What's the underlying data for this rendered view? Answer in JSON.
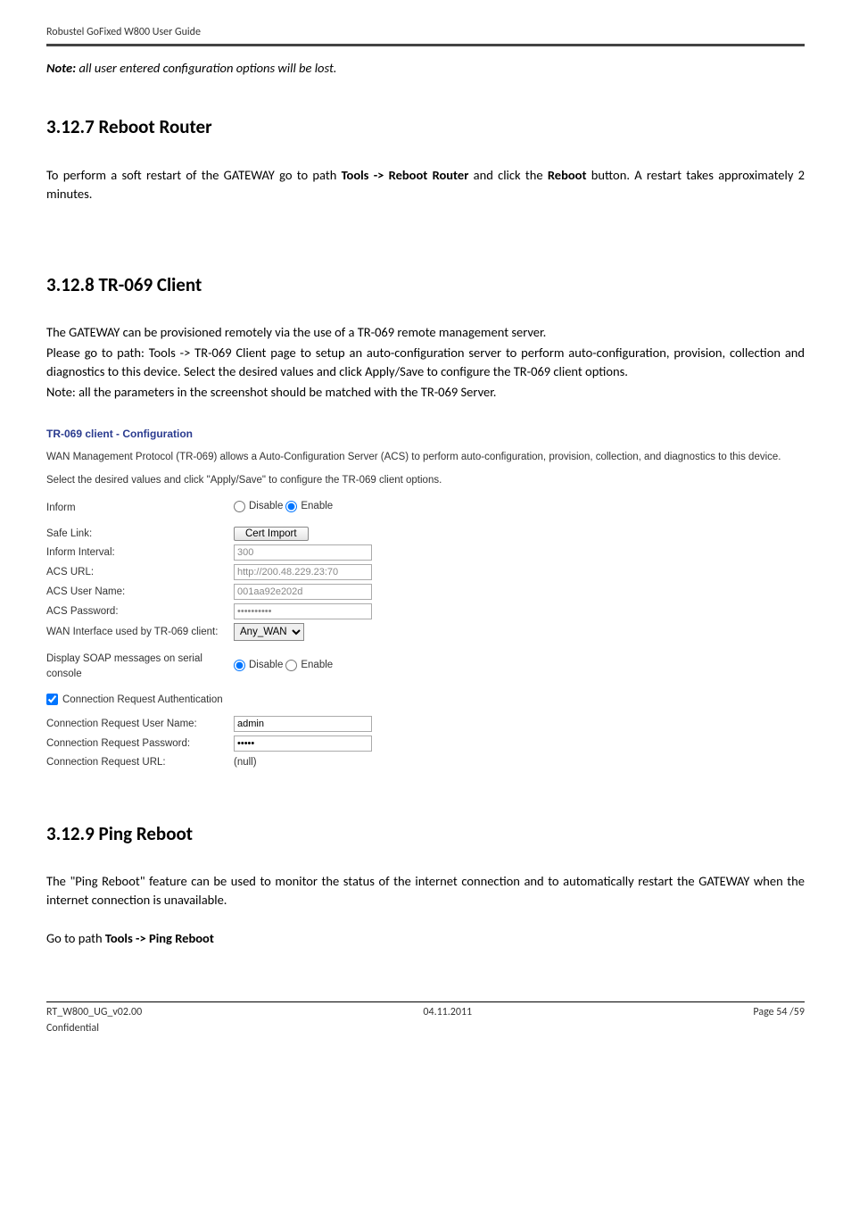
{
  "header": {
    "product": "Robustel GoFixed W800 User Guide"
  },
  "note": {
    "label": "Note:",
    "text": " all user entered configuration options will be lost."
  },
  "sections": {
    "s1_title": "3.12.7 Reboot Router",
    "s1_body": "To perform a soft restart of the GATEWAY go to path Tools -> Reboot Router and click the Reboot button. A restart takes approximately 2 minutes.",
    "s1_body_pre": "To perform a soft restart of the GATEWAY go to path ",
    "s1_bold1": "Tools -> Reboot Router",
    "s1_mid": " and click the ",
    "s1_bold2": "Reboot",
    "s1_post": " button. A restart takes approximately 2 minutes.",
    "s2_title": "3.12.8 TR-069 Client",
    "s2_p1": "The GATEWAY can be provisioned remotely via the use of a TR-069 remote management server.",
    "s2_p2": "Please go to path: Tools -> TR-069 Client page to setup an auto-configuration server to perform auto-configuration, provision, collection and diagnostics to this device. Select the desired values and click Apply/Save to configure the TR-069 client options.",
    "s2_p3": "Note: all the parameters in the screenshot should be matched with the TR-069 Server.",
    "s3_title": "3.12.9 Ping Reboot",
    "s3_p1": "The \"Ping Reboot\" feature can be used to monitor the status of the internet connection and to automatically restart the GATEWAY when the internet connection is unavailable.",
    "s3_p2_pre": "Go to path ",
    "s3_p2_bold": "Tools -> Ping Reboot"
  },
  "tr069": {
    "title": "TR-069 client - Configuration",
    "desc1": "WAN Management Protocol (TR-069) allows a Auto-Configuration Server (ACS) to perform auto-configuration, provision, collection, and diagnostics to this device.",
    "desc2": "Select the desired values and click \"Apply/Save\" to configure the TR-069 client options.",
    "labels": {
      "inform": "Inform",
      "safelink": "Safe Link:",
      "interval": "Inform Interval:",
      "acsurl": "ACS URL:",
      "acsuser": "ACS User Name:",
      "acspass": "ACS Password:",
      "wanif": "WAN Interface used by TR-069 client:",
      "soap": "Display SOAP messages on serial console",
      "connauth": "Connection Request Authentication",
      "cruser": "Connection Request User Name:",
      "crpass": "Connection Request Password:",
      "crurl": "Connection Request URL:"
    },
    "radio": {
      "disable": "Disable",
      "enable": "Enable"
    },
    "values": {
      "cert_button": "Cert Import",
      "interval": "300",
      "acsurl": "http://200.48.229.23:70",
      "acsuser": "001aa92e202d",
      "acspass": "••••••••••",
      "wanif": "Any_WAN",
      "cruser": "admin",
      "crpass": "•••••",
      "crurl": "(null)"
    }
  },
  "footer": {
    "left1": "RT_W800_UG_v02.00",
    "left2": "Confidential",
    "center": "04.11.2011",
    "right": "Page 54 /59"
  }
}
